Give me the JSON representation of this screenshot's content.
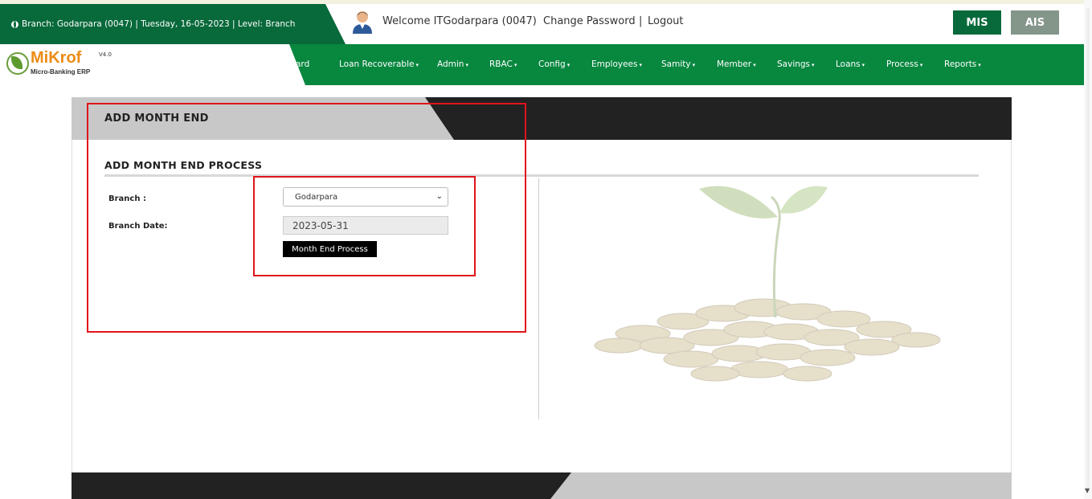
{
  "header": {
    "branch_info": "Branch: Godarpara (0047) | Tuesday, 16-05-2023 | Level: Branch",
    "welcome": "Welcome ITGodarpara (0047)",
    "change_password": "Change Password",
    "separator": "|",
    "logout": "Logout",
    "mis_label": "MIS",
    "ais_label": "AIS"
  },
  "logo": {
    "name": "MiKrof",
    "version": "V4.0",
    "subtitle": "Micro-Banking ERP"
  },
  "nav": {
    "items": [
      {
        "label": "ard",
        "has_caret": false
      },
      {
        "label": "Loan Recoverable",
        "has_caret": true
      },
      {
        "label": "Admin",
        "has_caret": true
      },
      {
        "label": "RBAC",
        "has_caret": true
      },
      {
        "label": "Config",
        "has_caret": true
      },
      {
        "label": "Employees",
        "has_caret": true
      },
      {
        "label": "Samity",
        "has_caret": true
      },
      {
        "label": "Member",
        "has_caret": true
      },
      {
        "label": "Savings",
        "has_caret": true
      },
      {
        "label": "Loans",
        "has_caret": true
      },
      {
        "label": "Process",
        "has_caret": true
      },
      {
        "label": "Reports",
        "has_caret": true
      }
    ]
  },
  "panel": {
    "title": "ADD MONTH END",
    "section_title": "ADD MONTH END PROCESS",
    "branch_label": "Branch :",
    "branch_value": "Godarpara",
    "branch_date_label": "Branch Date:",
    "branch_date_value": "2023-05-31",
    "submit_label": "Month End Process"
  },
  "icons": {
    "globe": "globe-icon",
    "user": "user-avatar-icon",
    "select_chevron": "chevron-down-icon",
    "caret": "caret-down-icon"
  },
  "colors": {
    "brand_green": "#08693a",
    "nav_green": "#08873f",
    "logo_orange": "#ec8b14",
    "highlight_red": "#e0141b",
    "ais_gray": "#84958a"
  }
}
